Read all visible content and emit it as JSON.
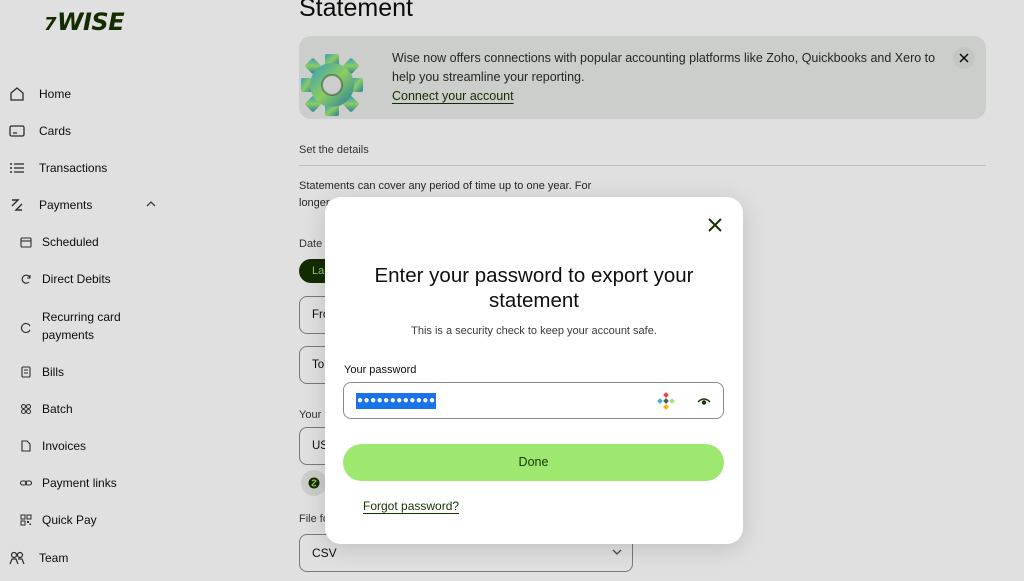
{
  "sidebar": {
    "logo": "WISE",
    "logo_flag": "7",
    "items": [
      {
        "label": "Home",
        "icon": "house-icon"
      },
      {
        "label": "Cards",
        "icon": "card-icon"
      },
      {
        "label": "Transactions",
        "icon": "list-icon"
      },
      {
        "label": "Payments",
        "icon": "transfer-arrows-icon",
        "expanded_icon": "chevron-up-icon"
      },
      {
        "label": "Scheduled",
        "icon": "calendar-icon"
      },
      {
        "label": "Direct Debits",
        "icon": "refresh-icon"
      },
      {
        "label": "Recurring card payments",
        "icon": "recurring-icon"
      },
      {
        "label": "Bills",
        "icon": "receipt-icon"
      },
      {
        "label": "Batch",
        "icon": "batch-icon"
      },
      {
        "label": "Invoices",
        "icon": "document-icon"
      },
      {
        "label": "Payment links",
        "icon": "link-icon"
      },
      {
        "label": "Quick Pay",
        "icon": "qr-icon"
      },
      {
        "label": "Team",
        "icon": "team-icon"
      }
    ]
  },
  "main": {
    "title": "Statement",
    "banner": {
      "text": "Wise now offers connections with popular accounting platforms like Zoho, Quickbooks and Xero to help you streamline your reporting.",
      "link": "Connect your account"
    },
    "section_label": "Set the details",
    "description": "Statements can cover any period of time up to one year. For longer",
    "date_label": "Date",
    "date_pill": "La",
    "from_field": "Fro",
    "to_field": "To",
    "your_label": "Your",
    "currency_field": "US",
    "file_format_label": "File fo",
    "file_format_value": "CSV"
  },
  "modal": {
    "title": "Enter your password to export your statement",
    "subtitle": "This is a security check to keep your account safe.",
    "password_label": "Your password",
    "password_value": "●●●●●●●●●●●●",
    "done_button": "Done",
    "forgot_link": "Forgot password?"
  },
  "colors": {
    "brand_dark": "#163300",
    "brand_green": "#9fe870",
    "selection_blue": "#1a73e8"
  }
}
